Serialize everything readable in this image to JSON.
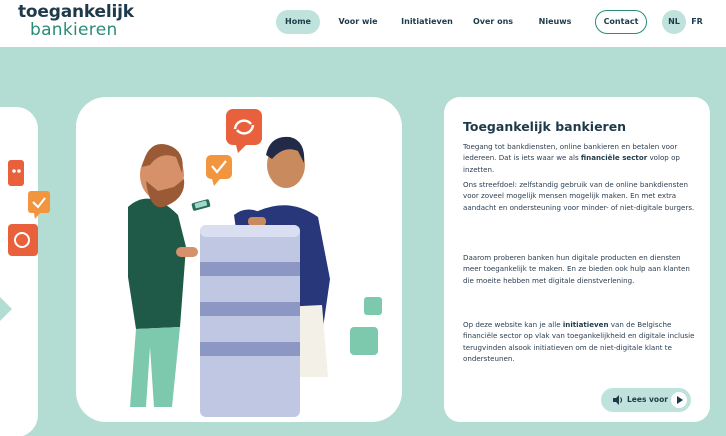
{
  "logo": {
    "line1": "toegankelijk",
    "line2": "bankieren"
  },
  "nav": {
    "home": "Home",
    "voor_wie": "Voor wie",
    "initiatieven": "Initiatieven",
    "over_ons": "Over ons",
    "nieuws": "Nieuws",
    "contact": "Contact",
    "lang_nl": "NL",
    "lang_fr": "FR"
  },
  "intro": {
    "title": "Toegankelijk bankieren",
    "p1_a": "Toegang tot bankdiensten, online bankieren en betalen voor iedereen. Dat is iets waar we als ",
    "p1_b": "financiële sector",
    "p1_c": " volop op inzetten.",
    "p2": "Ons streefdoel: zelfstandig gebruik van de online bankdiensten voor zoveel mogelijk mensen mogelijk maken. En met extra aandacht en ondersteuning voor minder- of niet-digitale burgers.",
    "p3": "Daarom proberen banken hun digitale producten en diensten meer toegankelijk te maken. En ze bieden ook hulp aan klanten die moeite hebben met digitale dienstverlening.",
    "p4_a": "Op deze website kan je alle ",
    "p4_b": "initiatieven",
    "p4_c": " van de Belgische financiële sector op vlak van toegankelijkheid en digitale inclusie terugvinden alsook initiatieven om de niet-digitale klant te ondersteunen."
  },
  "read_aloud": {
    "label": "Lees voor",
    "speaker_icon": "speaker-icon",
    "play_icon": "play-icon"
  },
  "colors": {
    "brand_dark": "#1e3a4a",
    "brand_green": "#2a8c76",
    "background": "#b3dcd2",
    "nav_active": "#bfe3dc",
    "accent_orange": "#e8613c"
  }
}
